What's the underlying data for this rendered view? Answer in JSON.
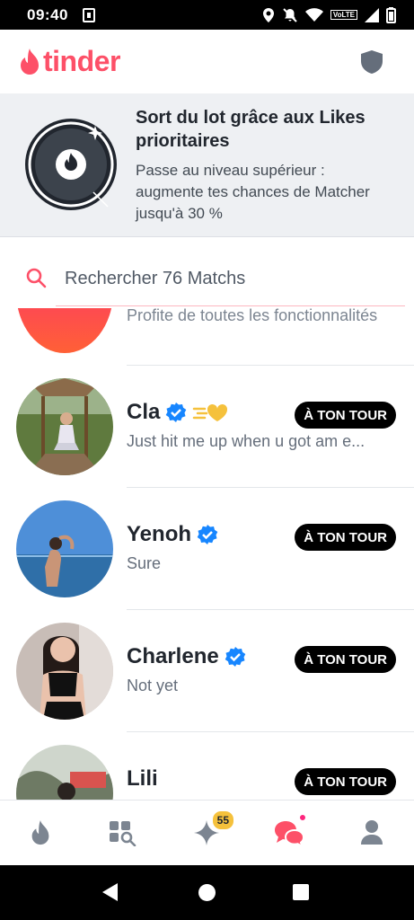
{
  "status_bar": {
    "time": "09:40",
    "network_badge": "VoLTE"
  },
  "header": {
    "logo_text": "tinder"
  },
  "promo": {
    "title": "Sort du lot grâce aux Likes prioritaires",
    "subtitle": "Passe au niveau supérieur : augmente tes chances de Matcher jusqu'à 30 %"
  },
  "search": {
    "placeholder": "Rechercher 76 Matchs"
  },
  "promo_row": {
    "text": "Profite de toutes les fonctionnalités"
  },
  "conversations": [
    {
      "name": "Cla",
      "message": "Just hit me up when u got am e...",
      "badge": "À TON TOUR",
      "verified": true,
      "super_like": true
    },
    {
      "name": "Yenoh",
      "message": "Sure",
      "badge": "À TON TOUR",
      "verified": true
    },
    {
      "name": "Charlene",
      "message": "Not yet",
      "badge": "À TON TOUR",
      "verified": true
    },
    {
      "name": "Lili",
      "message": "",
      "badge": "À TON TOUR",
      "verified": false
    }
  ],
  "bottom_nav": {
    "items": [
      "flame",
      "explore",
      "likes",
      "chat",
      "profile"
    ],
    "likes_badge": "55",
    "active_item": "chat"
  },
  "colors": {
    "brand": "#fd5068",
    "verified": "#1786ff",
    "gold": "#f5c13c"
  }
}
